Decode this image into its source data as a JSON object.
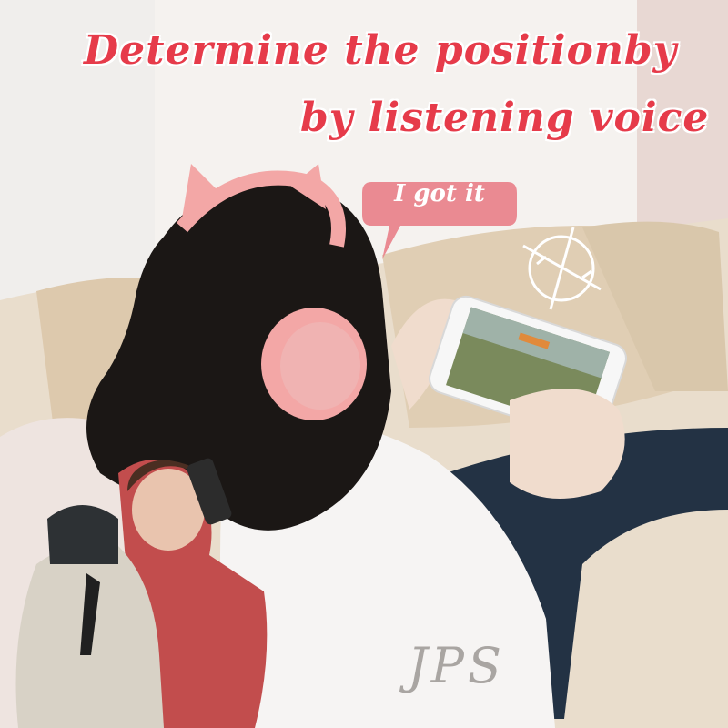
{
  "headline": {
    "line1": "Determine the positionby",
    "line2": "by listening voice"
  },
  "speech_bubble": {
    "text": "I got it",
    "color": "#ea8a92"
  },
  "watermark": "JPS",
  "colors": {
    "headline": "#e63b4a",
    "headphones": "#f3a7a6",
    "hair": "#1b1715",
    "sofa": "#e6d9c6",
    "jeans": "#233244"
  },
  "icons": [
    "crosshair-icon"
  ]
}
